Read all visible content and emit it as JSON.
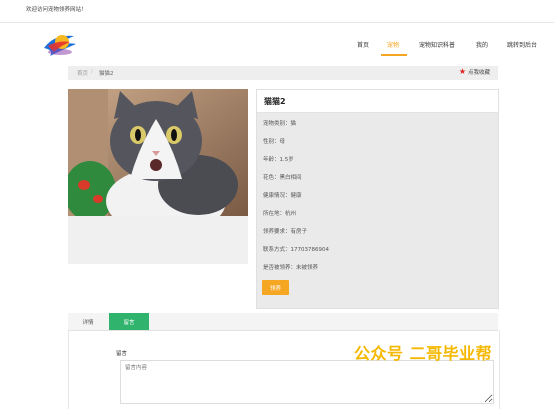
{
  "topbar": {
    "welcome": "欢迎访问宠物领养网站！"
  },
  "nav": {
    "items": [
      {
        "label": "首页"
      },
      {
        "label": "宠物"
      },
      {
        "label": "宠物知识科普"
      },
      {
        "label": "我的"
      },
      {
        "label": "跳转到后台"
      }
    ],
    "active_index": 1
  },
  "breadcrumb": {
    "home": "首页",
    "sep": "/",
    "current": "猫猫2",
    "favorite": "点我收藏"
  },
  "pet": {
    "title": "猫猫2",
    "rows": [
      "宠物类别：猫",
      "性别：母",
      "年龄：1.5岁",
      "花色：黑白相间",
      "健康情况：健康",
      "所在地：杭州",
      "领养要求：有房子",
      "联系方式：17703786904",
      "是否被领养：未被领养"
    ],
    "adopt_button": "领养"
  },
  "tabs": [
    {
      "label": "详情"
    },
    {
      "label": "留言"
    }
  ],
  "comment": {
    "label": "留言",
    "placeholder": "留言内容"
  },
  "watermark": "公众号 二哥毕业帮",
  "colors": {
    "accent": "#f5a623",
    "tab_active": "#2fb36d",
    "favorite_star": "#e02020"
  }
}
